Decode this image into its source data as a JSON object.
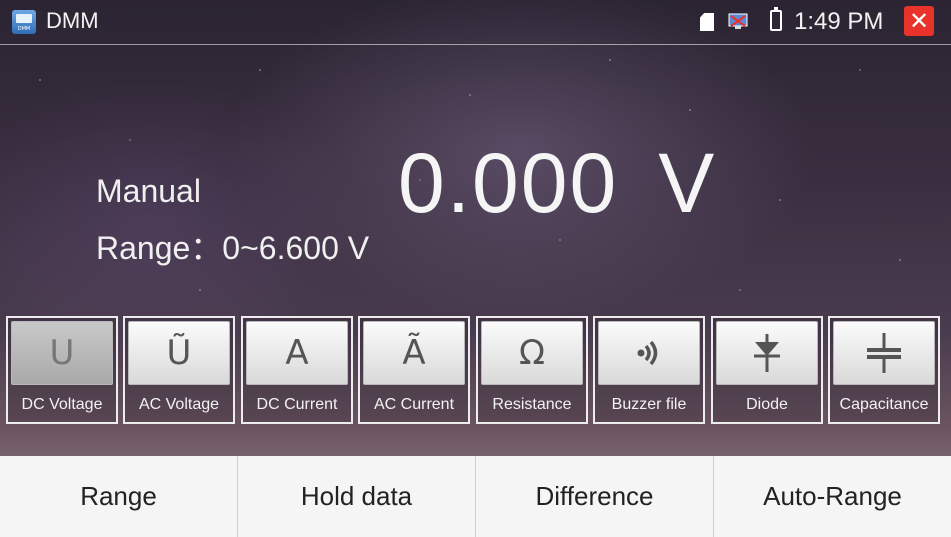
{
  "status_bar": {
    "app_title": "DMM",
    "app_icon_caption": "DMM",
    "time": "1:49 PM",
    "icons": [
      "sd-card-icon",
      "network-icon",
      "battery-icon",
      "close-icon"
    ],
    "close_symbol": "✕",
    "close_color": "#e8322a"
  },
  "display": {
    "mode": "Manual",
    "range": "Range：0~6.600 V",
    "value": "0.000",
    "unit": "V"
  },
  "functions": [
    {
      "symbol": "U",
      "label": "DC Voltage",
      "active": true
    },
    {
      "symbol": "Ũ",
      "label": "AC Voltage",
      "active": false
    },
    {
      "symbol": "A",
      "label": "DC Current",
      "active": false
    },
    {
      "symbol": "Ã",
      "label": "AC Current",
      "active": false
    },
    {
      "symbol": "Ω",
      "label": "Resistance",
      "active": false
    },
    {
      "symbol": "buzzer-icon",
      "label": "Buzzer file",
      "active": false
    },
    {
      "symbol": "diode-icon",
      "label": "Diode",
      "active": false
    },
    {
      "symbol": "capacitor-icon",
      "label": "Capacitance",
      "active": false
    }
  ],
  "bottom_bar": {
    "buttons": [
      "Range",
      "Hold data",
      "Difference",
      "Auto-Range"
    ]
  }
}
